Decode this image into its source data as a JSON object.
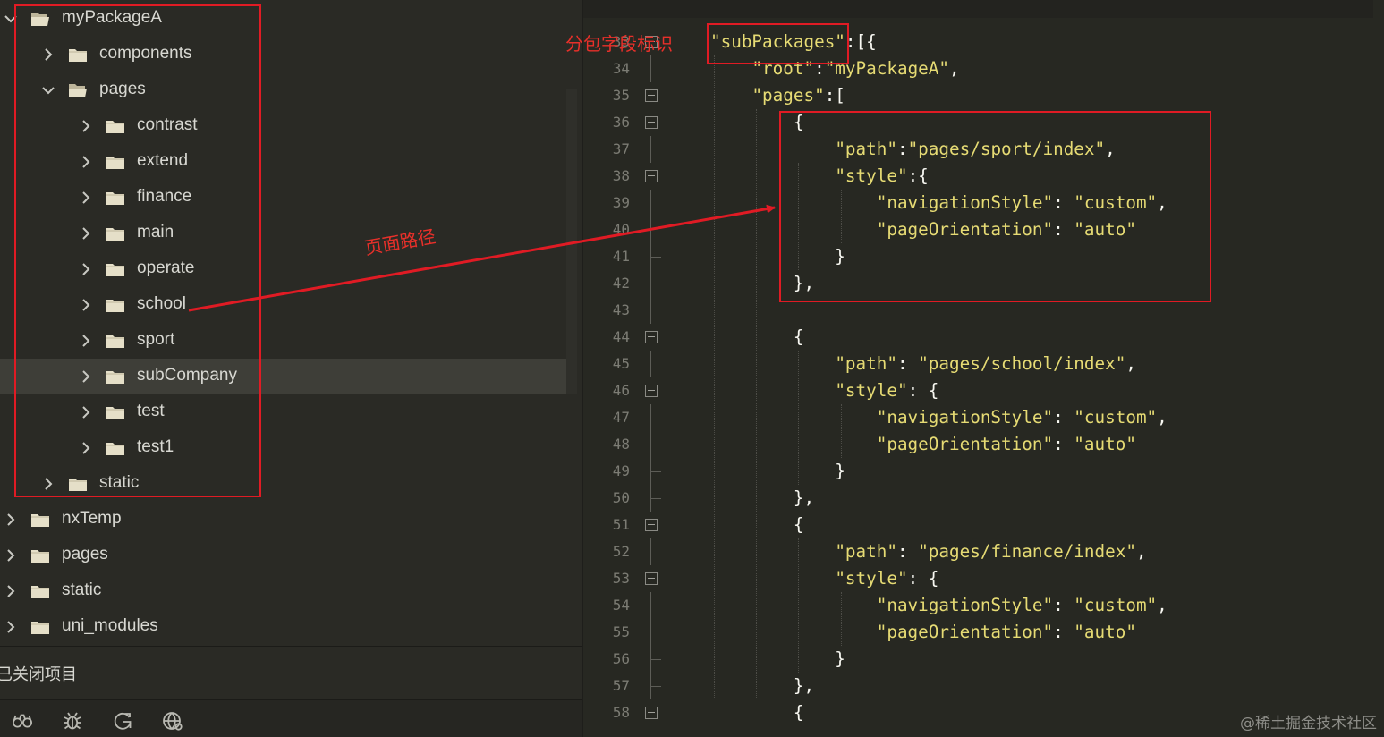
{
  "explorer": {
    "tree": [
      {
        "label": "myPackageA",
        "depth": 0,
        "expanded": true,
        "selected": false
      },
      {
        "label": "components",
        "depth": 1,
        "expanded": false,
        "selected": false
      },
      {
        "label": "pages",
        "depth": 1,
        "expanded": true,
        "selected": false
      },
      {
        "label": "contrast",
        "depth": 2,
        "expanded": false,
        "selected": false
      },
      {
        "label": "extend",
        "depth": 2,
        "expanded": false,
        "selected": false
      },
      {
        "label": "finance",
        "depth": 2,
        "expanded": false,
        "selected": false
      },
      {
        "label": "main",
        "depth": 2,
        "expanded": false,
        "selected": false
      },
      {
        "label": "operate",
        "depth": 2,
        "expanded": false,
        "selected": false
      },
      {
        "label": "school",
        "depth": 2,
        "expanded": false,
        "selected": false
      },
      {
        "label": "sport",
        "depth": 2,
        "expanded": false,
        "selected": false
      },
      {
        "label": "subCompany",
        "depth": 2,
        "expanded": false,
        "selected": true
      },
      {
        "label": "test",
        "depth": 2,
        "expanded": false,
        "selected": false
      },
      {
        "label": "test1",
        "depth": 2,
        "expanded": false,
        "selected": false
      },
      {
        "label": "static",
        "depth": 1,
        "expanded": false,
        "selected": false
      },
      {
        "label": "nxTemp",
        "depth": 0,
        "expanded": false,
        "selected": false
      },
      {
        "label": "pages",
        "depth": 0,
        "expanded": false,
        "selected": false
      },
      {
        "label": "static",
        "depth": 0,
        "expanded": false,
        "selected": false
      },
      {
        "label": "uni_modules",
        "depth": 0,
        "expanded": false,
        "selected": false
      }
    ],
    "closed_projects_label": "已关闭项目",
    "toolbar_icons": [
      "binoculars-icon",
      "bug-icon",
      "refresh-icon",
      "globe-icon"
    ]
  },
  "editor": {
    "lines": [
      {
        "num": "33",
        "fold": true,
        "html": "<span class=\"k\">\"subPackages\"</span>:[{"
      },
      {
        "num": "34",
        "fold": false,
        "html": "    <span class=\"k\">\"root\"</span>:<span class=\"k\">\"myPackageA\"</span>,"
      },
      {
        "num": "35",
        "fold": true,
        "html": "    <span class=\"k\">\"pages\"</span>:["
      },
      {
        "num": "36",
        "fold": true,
        "html": "        {"
      },
      {
        "num": "37",
        "fold": false,
        "html": "            <span class=\"k\">\"path\"</span>:<span class=\"k\">\"pages/sport/index\"</span>,"
      },
      {
        "num": "38",
        "fold": true,
        "html": "            <span class=\"k\">\"style\"</span>:{"
      },
      {
        "num": "39",
        "fold": false,
        "html": "                <span class=\"k\">\"navigationStyle\"</span>: <span class=\"k\">\"custom\"</span>,"
      },
      {
        "num": "40",
        "fold": false,
        "html": "                <span class=\"k\">\"pageOrientation\"</span>: <span class=\"k\">\"auto\"</span>"
      },
      {
        "num": "41",
        "fold": false,
        "html": "            }"
      },
      {
        "num": "42",
        "fold": false,
        "html": "        },"
      },
      {
        "num": "43",
        "fold": false,
        "html": ""
      },
      {
        "num": "44",
        "fold": true,
        "html": "        {"
      },
      {
        "num": "45",
        "fold": false,
        "html": "            <span class=\"k\">\"path\"</span>: <span class=\"k\">\"pages/school/index\"</span>,"
      },
      {
        "num": "46",
        "fold": true,
        "html": "            <span class=\"k\">\"style\"</span>: {"
      },
      {
        "num": "47",
        "fold": false,
        "html": "                <span class=\"k\">\"navigationStyle\"</span>: <span class=\"k\">\"custom\"</span>,"
      },
      {
        "num": "48",
        "fold": false,
        "html": "                <span class=\"k\">\"pageOrientation\"</span>: <span class=\"k\">\"auto\"</span>"
      },
      {
        "num": "49",
        "fold": false,
        "html": "            }"
      },
      {
        "num": "50",
        "fold": false,
        "html": "        },"
      },
      {
        "num": "51",
        "fold": true,
        "html": "        {"
      },
      {
        "num": "52",
        "fold": false,
        "html": "            <span class=\"k\">\"path\"</span>: <span class=\"k\">\"pages/finance/index\"</span>,"
      },
      {
        "num": "53",
        "fold": true,
        "html": "            <span class=\"k\">\"style\"</span>: {"
      },
      {
        "num": "54",
        "fold": false,
        "html": "                <span class=\"k\">\"navigationStyle\"</span>: <span class=\"k\">\"custom\"</span>,"
      },
      {
        "num": "55",
        "fold": false,
        "html": "                <span class=\"k\">\"pageOrientation\"</span>: <span class=\"k\">\"auto\"</span>"
      },
      {
        "num": "56",
        "fold": false,
        "html": "            }"
      },
      {
        "num": "57",
        "fold": false,
        "html": "        },"
      },
      {
        "num": "58",
        "fold": true,
        "html": "        {"
      }
    ]
  },
  "annotations": {
    "subpackage_marker": "分包字段标识",
    "page_path": "页面路径"
  },
  "watermark": "@稀土掘金技术社区",
  "colors": {
    "annotation_red": "#e01b24",
    "string_yellow": "#e6db74",
    "editor_bg": "#272822",
    "explorer_bg": "#2a2a25",
    "selected_row_bg": "#3e3e38"
  }
}
